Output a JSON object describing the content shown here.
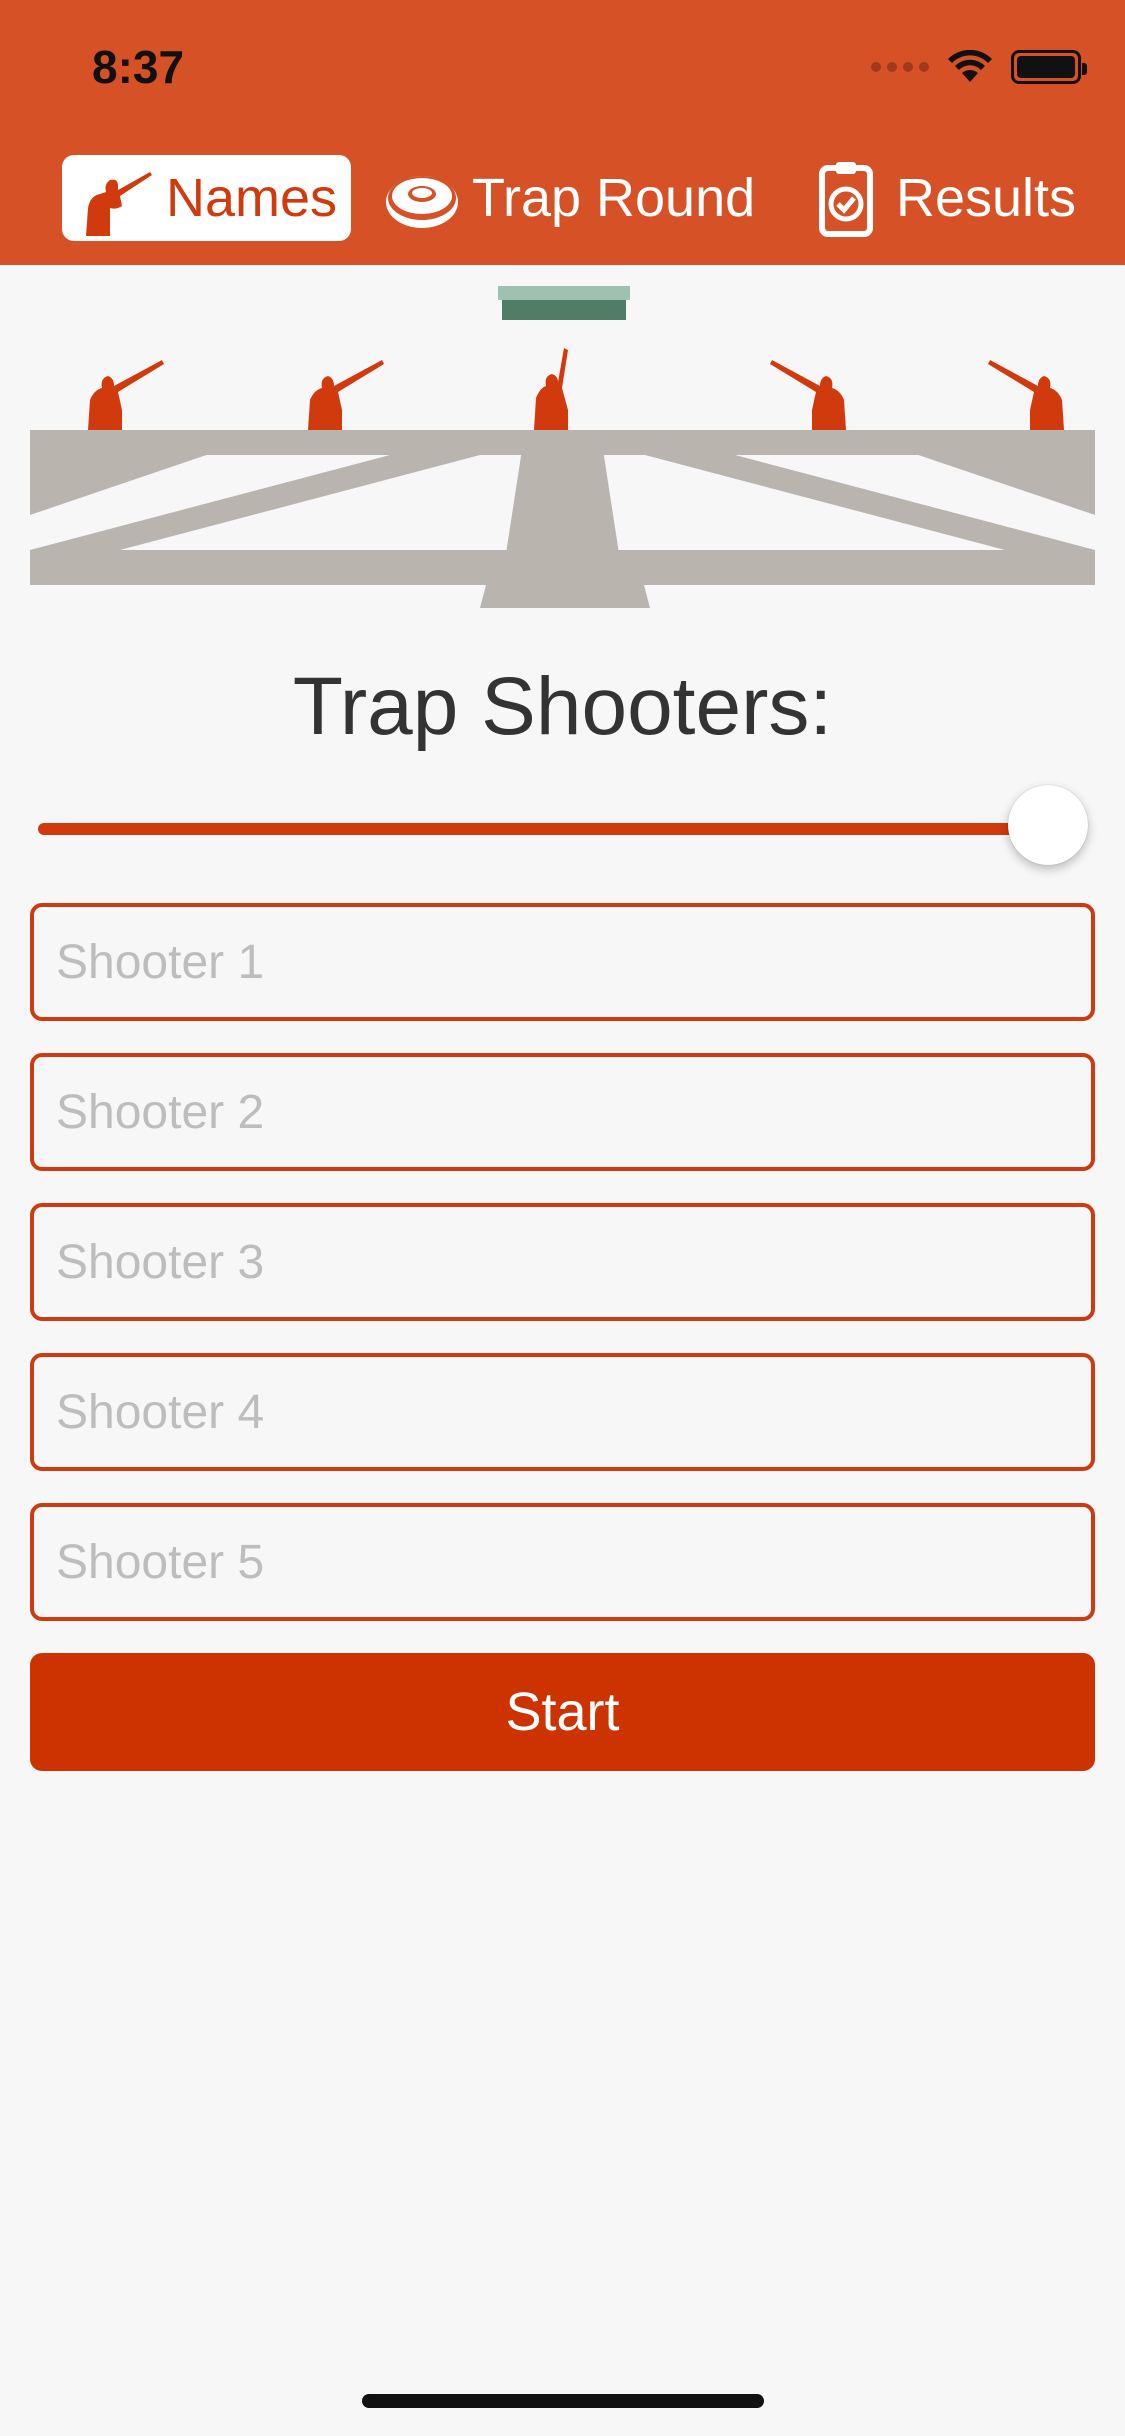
{
  "status_bar": {
    "time": "8:37"
  },
  "tabs": [
    {
      "label": "Names",
      "icon": "shooter-icon",
      "active": true
    },
    {
      "label": "Trap Round",
      "icon": "clay-target-icon",
      "active": false
    },
    {
      "label": "Results",
      "icon": "clipboard-check-icon",
      "active": false
    }
  ],
  "title": "Trap Shooters:",
  "slider": {
    "value": 5,
    "max": 5
  },
  "shooters": [
    {
      "placeholder": "Shooter 1",
      "value": ""
    },
    {
      "placeholder": "Shooter 2",
      "value": ""
    },
    {
      "placeholder": "Shooter 3",
      "value": ""
    },
    {
      "placeholder": "Shooter 4",
      "value": ""
    },
    {
      "placeholder": "Shooter 5",
      "value": ""
    }
  ],
  "start_label": "Start",
  "colors": {
    "header": "#d65226",
    "accent": "#cc3300",
    "field": "#b9b4ae",
    "trap_house": "#4f7d66"
  }
}
